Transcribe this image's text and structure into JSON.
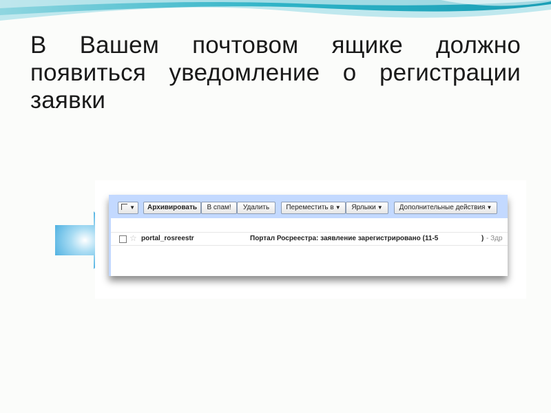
{
  "slide": {
    "title": "В Вашем почтовом ящике должно появиться уведомление о регистрации заявки",
    "colors": {
      "header_teal": "#2fb3c7",
      "header_light": "#bfe8ee",
      "arrow_blue": "#3aa7dd"
    },
    "arrow_icon": "right-arrow-icon"
  },
  "toolbar": {
    "archive_label": "Архивировать",
    "spam_label": "В спам!",
    "delete_label": "Удалить",
    "move_label": "Переместить в",
    "labels_label": "Ярлыки",
    "more_label": "Дополнительные действия",
    "background": "#c3d9ff"
  },
  "mail": {
    "sender": "portal_rosreestr",
    "subject": "Портал Росреестра: заявление зарегистрировано (11-5",
    "subject_close": ")",
    "snippet": "- Здр"
  }
}
